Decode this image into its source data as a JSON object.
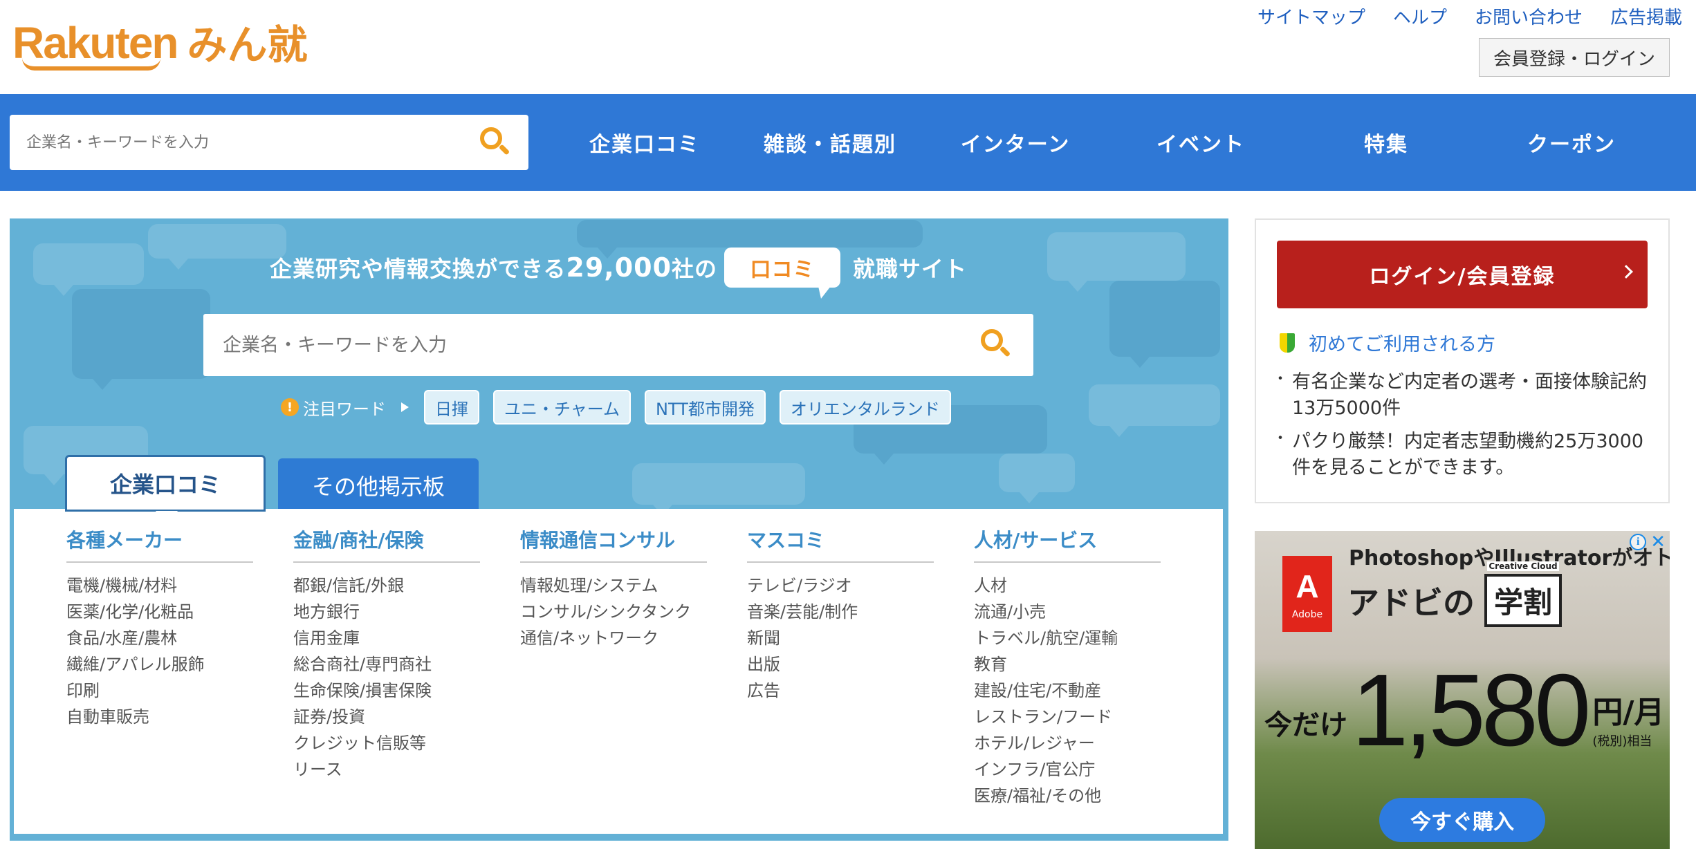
{
  "logo": {
    "brand": "Rakuten",
    "product": "みん就"
  },
  "header": {
    "links": [
      "サイトマップ",
      "ヘルプ",
      "お問い合わせ",
      "広告掲載"
    ],
    "member_button": "会員登録・ログイン"
  },
  "nav": {
    "search_placeholder": "企業名・キーワードを入力",
    "items": [
      "企業口コミ",
      "雑談・話題別",
      "インターン",
      "イベント",
      "特集",
      "クーポン"
    ]
  },
  "hero": {
    "headline_pre": "企業研究や情報交換ができる",
    "headline_num": "29,000",
    "headline_mid": "社の",
    "badge": "口コミ",
    "headline_post": "就職サイト",
    "search_placeholder": "企業名・キーワードを入力",
    "trend_label": "注目ワード",
    "trend_tags": [
      "日揮",
      "ユニ・チャーム",
      "NTT都市開発",
      "オリエンタルランド"
    ],
    "tabs": [
      "企業口コミ",
      "その他掲示板"
    ]
  },
  "categories": [
    {
      "title": "各種メーカー",
      "items": [
        "電機/機械/材料",
        "医薬/化学/化粧品",
        "食品/水産/農林",
        "繊維/アパレル服飾",
        "印刷",
        "自動車販売"
      ]
    },
    {
      "title": "金融/商社/保険",
      "items": [
        "都銀/信託/外銀",
        "地方銀行",
        "信用金庫",
        "総合商社/専門商社",
        "生命保険/損害保険",
        "証券/投資",
        "クレジット信販等",
        "リース"
      ]
    },
    {
      "title": "情報通信コンサル",
      "items": [
        "情報処理/システム",
        "コンサル/シンクタンク",
        "通信/ネットワーク"
      ]
    },
    {
      "title": "マスコミ",
      "items": [
        "テレビ/ラジオ",
        "音楽/芸能/制作",
        "新聞",
        "出版",
        "広告"
      ]
    },
    {
      "title": "人材/サービス",
      "items": [
        "人材",
        "流通/小売",
        "トラベル/航空/運輸",
        "教育",
        "建設/住宅/不動産",
        "レストラン/フード",
        "ホテル/レジャー",
        "インフラ/官公庁",
        "医療/福祉/その他"
      ]
    }
  ],
  "sidebar": {
    "login_button": "ログイン/会員登録",
    "first_time_link": "初めてご利用される方",
    "bullets": [
      "有名企業など内定者の選考・面接体験記約13万5000件",
      "パクり厳禁！内定者志望動機約25万3000件を見ることができます。"
    ]
  },
  "ad": {
    "line1": "PhotoshopやIllustratorがオトク",
    "line2_pre": "アドビの",
    "line2_badge": "学割",
    "badge_caption": "Creative Cloud",
    "logo_text": "Adobe",
    "price_prefix": "今だけ",
    "price": "1,580",
    "price_unit": "円/月",
    "price_note": "(税別)相当",
    "cta": "今すぐ購入"
  },
  "colors": {
    "brand_orange": "#e8902a",
    "nav_blue": "#2f78d6",
    "hero_blue": "#63b1d6",
    "login_red": "#b8201c",
    "link_blue": "#1f5fbf"
  }
}
